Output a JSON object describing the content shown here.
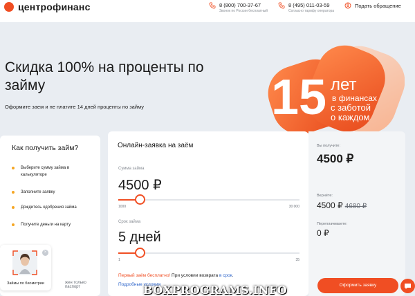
{
  "header": {
    "logo_text": "центрофинанс",
    "phone1": {
      "number": "8 (800) 700-37-67",
      "note": "Звонок по России бесплатный"
    },
    "phone2": {
      "number": "8 (495) 011-03-59",
      "note": "Согласно тарифу оператора"
    },
    "complaint_label": "Подать обращение"
  },
  "hero": {
    "title": "Скидка 100% на проценты по займу",
    "subtitle": "Оформите заем и не платите 14 дней проценты по займу",
    "badge": {
      "number": "15",
      "years": "лет",
      "line1": "в финансах",
      "line2": "с заботой",
      "line3": "о каждом"
    }
  },
  "how": {
    "title": "Как получить займ?",
    "steps": [
      "Выберите сумму займа в калькуляторе",
      "Заполните заявку",
      "Дождитесь одобрения займа",
      "Получите деньги на карту"
    ],
    "bottom_text": "жен только паспорт"
  },
  "biometrics": {
    "label": "Займы по биометрии",
    "close": "×"
  },
  "calculator": {
    "title": "Онлайн-заявка на заём",
    "amount": {
      "label": "Сумма займа",
      "value": "4500 ₽",
      "min": "1000",
      "max": "30 000",
      "fraction": 0.12
    },
    "term": {
      "label": "Срок займа",
      "value": "5 дней",
      "min": "1",
      "max": "35",
      "fraction": 0.12
    },
    "free_red": "Первый заём бесплатно!",
    "free_mid": " При условии возврата ",
    "free_blue": "в срок",
    "free_end": ".",
    "details": "Подробные условия"
  },
  "summary": {
    "receive_label": "Вы получите:",
    "receive_value": "4500 ₽",
    "return_label": "Вернёте:",
    "return_value": "4500 ₽",
    "return_old": "4680 ₽",
    "overpay_label": "Переплачиваете:",
    "overpay_value": "0 ₽",
    "apply_label": "Оформить заявку"
  },
  "watermark": "BOXPROGRAMS.INFO",
  "colors": {
    "accent": "#f04e23",
    "link": "#2a62c9",
    "bullet": "#f5a623",
    "background": "#e9edf2"
  }
}
